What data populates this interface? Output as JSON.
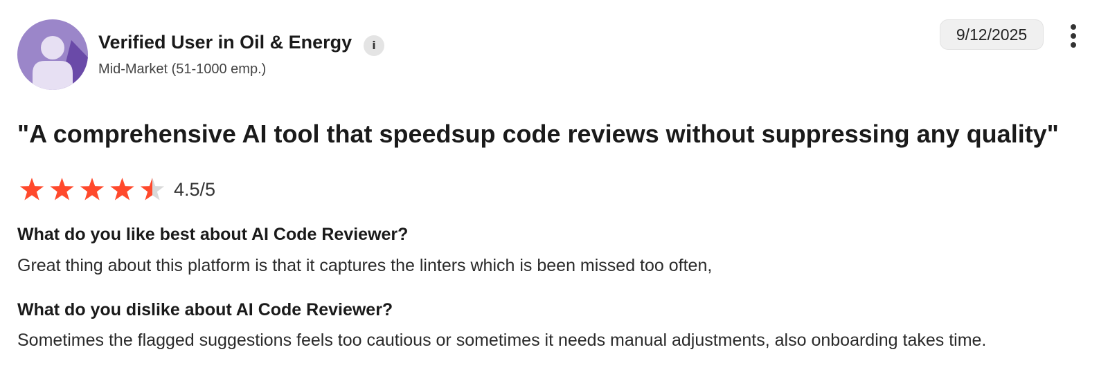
{
  "reviewer": {
    "name": "Verified User in Oil & Energy",
    "info_icon_glyph": "i",
    "company_size": "Mid-Market (51-1000 emp.)",
    "avatar_icon": "user-silhouette-icon",
    "avatar_color": "#9b86c9"
  },
  "review": {
    "date": "9/12/2025",
    "more_icon": "more-vertical-icon",
    "title": "\"A comprehensive AI tool that speedsup code reviews without suppressing any quality\"",
    "rating": {
      "value": 4.5,
      "max": 5,
      "label": "4.5/5",
      "star_color": "#ff492c",
      "empty_star_color": "#d9d9d9"
    },
    "sections": [
      {
        "question": "What do you like best about AI Code Reviewer?",
        "answer": "Great thing about this platform is that it captures the linters which is been missed too often,"
      },
      {
        "question": "What do you dislike about AI Code Reviewer?",
        "answer": "Sometimes the flagged suggestions feels too cautious or sometimes it needs manual adjustments, also onboarding takes time."
      }
    ]
  }
}
